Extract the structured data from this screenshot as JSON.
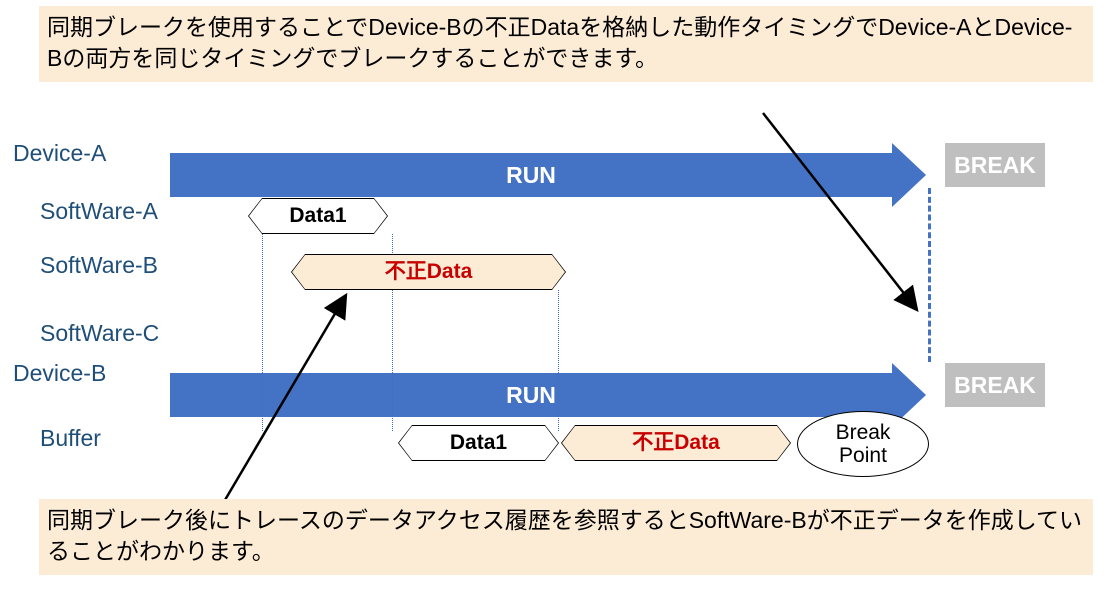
{
  "notes": {
    "top": "同期ブレークを使用することでDevice-Bの不正Dataを格納した動作タイミングでDevice-AとDevice-Bの両方を同じタイミングでブレークすることができます。",
    "bottom": "同期ブレーク後にトレースのデータアクセス履歴を参照するとSoftWare-Bが不正データを作成していることがわかります。"
  },
  "labels": {
    "deviceA": "Device-A",
    "swA": "SoftWare-A",
    "swB": "SoftWare-B",
    "swC": "SoftWare-C",
    "deviceB": "Device-B",
    "buffer": "Buffer"
  },
  "run": {
    "label": "RUN",
    "breakLabel": "BREAK"
  },
  "capsules": {
    "data1": "Data1",
    "badData": "不正Data"
  },
  "breakpoint": {
    "line1": "Break",
    "line2": "Point"
  }
}
